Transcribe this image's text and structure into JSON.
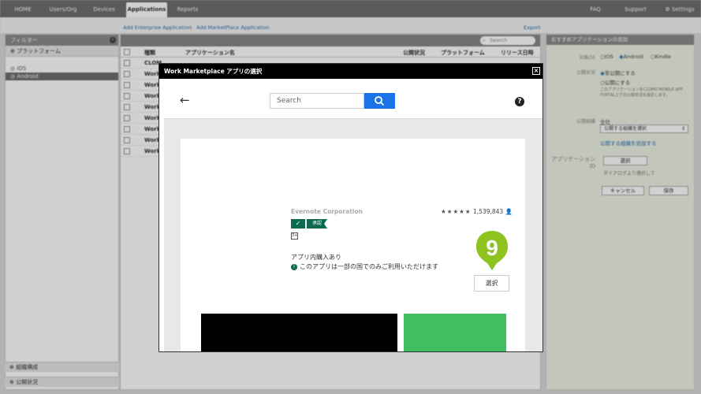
{
  "topnav": {
    "tabs": [
      {
        "label": "HOME"
      },
      {
        "label": "Users/Org"
      },
      {
        "label": "Devices"
      },
      {
        "label": "Applications"
      },
      {
        "label": "Reports"
      }
    ],
    "right": [
      {
        "label": "FAQ"
      },
      {
        "label": "Support"
      },
      {
        "label": "Settings"
      }
    ]
  },
  "subbar": {
    "add_enterprise": "Add Enterprise Application",
    "separator": "|",
    "add_marketplace": "Add MarketPlace Application",
    "export": "Export"
  },
  "left": {
    "title": "フィルター",
    "platform_section": "プラットフォーム",
    "items": [
      {
        "label": "iOS"
      },
      {
        "label": "Android"
      }
    ],
    "bottom": [
      {
        "label": "組織構成"
      },
      {
        "label": "公開状況"
      }
    ]
  },
  "center": {
    "search_placeholder": "Search",
    "columns": [
      "種類",
      "アプリケーション名",
      "公開状況",
      "プラットフォーム",
      "リリース日時"
    ],
    "rows": [
      {
        "name": "CLOM"
      },
      {
        "name": "Work"
      },
      {
        "name": "Work"
      },
      {
        "name": "Work"
      },
      {
        "name": "Work"
      },
      {
        "name": "Work"
      },
      {
        "name": "Work"
      },
      {
        "name": "Work"
      },
      {
        "name": "Work"
      }
    ]
  },
  "right": {
    "title": "おすすめアプリケーションの追加",
    "os_label": "対象OS",
    "os_options": [
      "iOS",
      "Android",
      "Kindle"
    ],
    "public_label": "公開状況",
    "public_options": [
      "非公開にする",
      "公開にする"
    ],
    "public_note": "このアプリケーションをCLOMO MOBILE APP PORTAL上での公開状況を設定します。",
    "org_label": "公開組織",
    "org_value": "全社",
    "org_select": "公開する組織を選択",
    "org_add": "公開する組織を追加する",
    "appid_label": "アプリケーションID",
    "select_button": "選択",
    "appid_note": "ダイアログより選択して",
    "cancel_button": "キャンセル",
    "save_button": "保存"
  },
  "modal": {
    "title": "Work Marketplace アプリの選択",
    "search_placeholder": "Search",
    "developer": "Evernote Corporation",
    "stars": "★★★★★",
    "rating_count": "1,539,843",
    "badge_label": "承認",
    "content_rating": "3+",
    "in_app_purchase": "アプリ内購入あり",
    "country_note": "このアプリは一部の国でのみご利用いただけます",
    "select_button": "選択",
    "marker_number": "9",
    "marker_color": "#8dc21f"
  }
}
